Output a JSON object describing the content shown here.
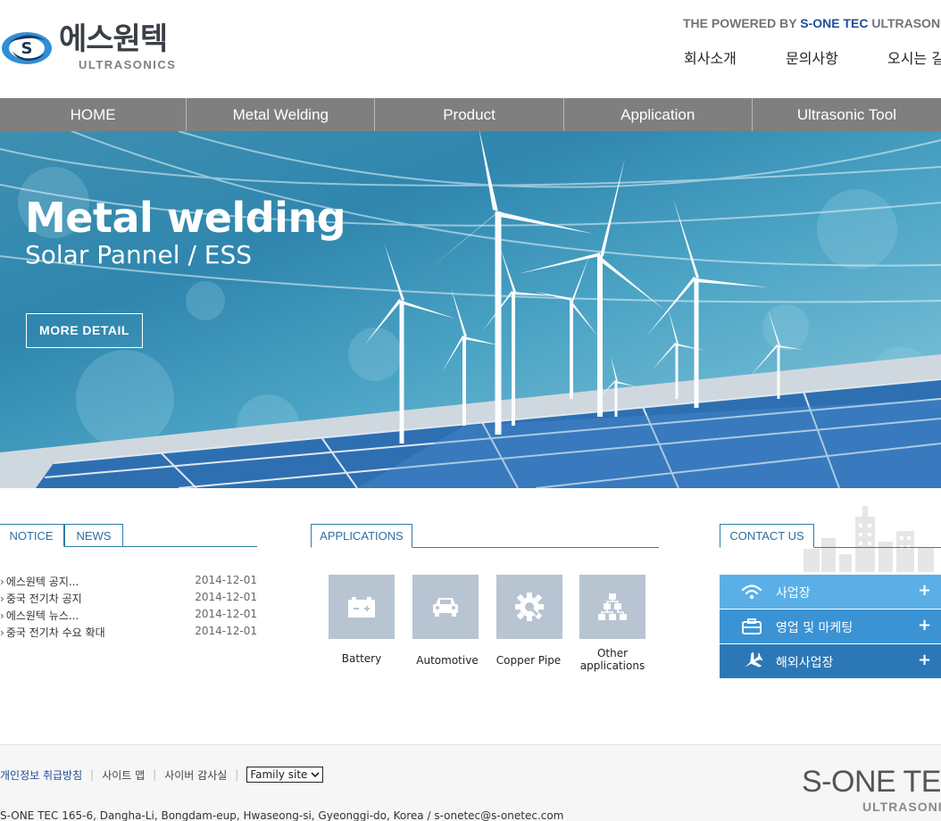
{
  "header": {
    "logo_text": "에스원텍",
    "logo_sub": "ULTRASONICS",
    "powered_prefix": "THE POWERED BY",
    "powered_brand": "S-ONE TEC",
    "powered_suffix": "ULTRASONICS",
    "util_nav": [
      "회사소개",
      "문의사항",
      "오시는 길"
    ]
  },
  "nav": {
    "items": [
      "HOME",
      "Metal Welding",
      "Product",
      "Application",
      "Ultrasonic Tool"
    ]
  },
  "hero": {
    "title": "Metal welding",
    "subtitle": "Solar Pannel / ESS",
    "button": "MORE DETAIL"
  },
  "notice": {
    "tabs": [
      "NOTICE",
      "NEWS"
    ],
    "items": [
      {
        "title": "에스원텍 공지...",
        "date": "2014-12-01"
      },
      {
        "title": "중국 전기차 공지",
        "date": "2014-12-01"
      },
      {
        "title": "에스원텍 뉴스...",
        "date": "2014-12-01"
      },
      {
        "title": "중국 전기차 수요 확대",
        "date": "2014-12-01"
      }
    ]
  },
  "applications": {
    "tab": "APPLICATIONS",
    "items": [
      {
        "label": "Battery",
        "icon": "battery-icon"
      },
      {
        "label": "Automotive",
        "icon": "car-icon"
      },
      {
        "label": "Copper Pipe",
        "icon": "gear-icon"
      },
      {
        "label": "Other applications",
        "icon": "sitemap-icon"
      }
    ]
  },
  "contact": {
    "tab": "CONTACT US",
    "rows": [
      {
        "label": "사업장",
        "icon": "wifi-icon",
        "color": "#5ab0e6"
      },
      {
        "label": "영업 및 마케팅",
        "icon": "briefcase-icon",
        "color": "#3b93d4"
      },
      {
        "label": "해외사업장",
        "icon": "airplane-icon",
        "color": "#2c78b7"
      }
    ]
  },
  "footer": {
    "links": [
      "개인정보 취급방침",
      "사이트 맵",
      "사이버 감사실"
    ],
    "family_site": "Family site",
    "address": "S-ONE TEC 165-6, Dangha-Li, Bongdam-eup, Hwaseong-si, Gyeonggi-do, Korea / s-onetec@s-onetec.com",
    "logo": "S-ONE TEC",
    "logo_sub": "ULTRASONICS"
  },
  "colors": {
    "nav_bg": "#7f7f7f",
    "accent_blue": "#2f7ea9",
    "brand_blue": "#1e4e9a"
  }
}
